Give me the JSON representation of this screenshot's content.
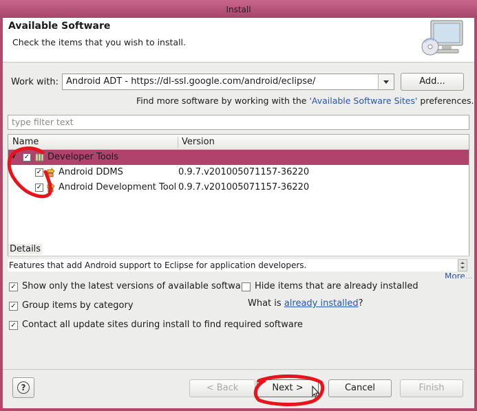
{
  "window": {
    "title": "Install"
  },
  "header": {
    "title": "Available Software",
    "description": "Check the items that you wish to install."
  },
  "work_with": {
    "label": "Work with:",
    "value": "Android ADT - https://dl-ssl.google.com/android/eclipse/",
    "add_button": "Add..."
  },
  "more_software": {
    "prefix": "Find more software by working with the ",
    "link": "'Available Software Sites'",
    "suffix": " preferences."
  },
  "filter": {
    "placeholder": "type filter text"
  },
  "tree": {
    "columns": {
      "name": "Name",
      "version": "Version"
    },
    "rows": [
      {
        "name": "Developer Tools",
        "version": "",
        "checked": true,
        "selected": true
      },
      {
        "name": "Android DDMS",
        "version": "0.9.7.v201005071157-36220",
        "checked": true
      },
      {
        "name": "Android Development Tool",
        "version": "0.9.7.v201005071157-36220",
        "checked": true
      }
    ]
  },
  "details": {
    "label": "Details",
    "text": "Features that add Android support to Eclipse for application developers.",
    "more_link": "More..."
  },
  "options": {
    "show_latest": {
      "label": "Show only the latest versions of available software",
      "checked": true
    },
    "hide_installed": {
      "label": "Hide items that are already installed",
      "checked": false
    },
    "group_by_category": {
      "label": "Group items by category",
      "checked": true
    },
    "what_is_prefix": "What is ",
    "already_installed_link": "already installed",
    "what_is_suffix": "?",
    "contact_sites": {
      "label": "Contact all update sites during install to find required software",
      "checked": true
    }
  },
  "buttons": {
    "help": "?",
    "back": "< Back",
    "next": "Next >",
    "cancel": "Cancel",
    "finish": "Finish"
  },
  "colors": {
    "selection": "#b0436c",
    "annotation_red": "#e8141c",
    "link": "#2a55a8"
  }
}
